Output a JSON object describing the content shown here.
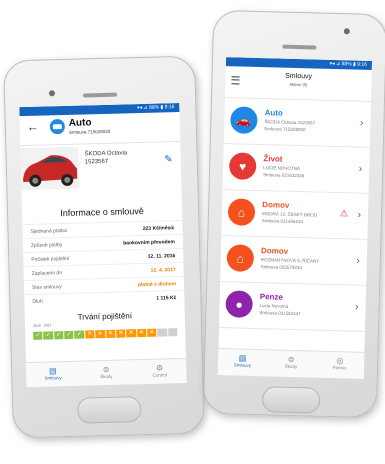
{
  "detail": {
    "status": "▾◂ ⊿ 88% ▮ 9:16",
    "title": "Auto",
    "subtitle": "Smlouva 715028030",
    "car_line1": "ŠKODA Octavia",
    "car_line2": "1523567",
    "info_title": "Informace o smlouvě",
    "rows": [
      {
        "k": "Sjednaná platba",
        "v": "223 Kč/měsíc",
        "warn": false
      },
      {
        "k": "Způsob platby",
        "v": "bankovním převodem",
        "warn": false
      },
      {
        "k": "Počátek pojištění",
        "v": "12. 11. 2016",
        "warn": false
      },
      {
        "k": "Zaplaceno do",
        "v": "12. 4. 2017",
        "warn": true
      },
      {
        "k": "Stav smlouvy",
        "v": "platná s dluhem",
        "warn": true
      },
      {
        "k": "Dluh",
        "v": "1 115 Kč",
        "warn": false
      }
    ],
    "duration_title": "Trvání pojištění",
    "year_a": "2016",
    "year_b": "2017",
    "timeline": [
      "ok",
      "ok",
      "ok",
      "ok",
      "ok",
      "x",
      "x",
      "x",
      "x",
      "x",
      "x",
      "x",
      "f",
      "f"
    ],
    "timeline_colors": {
      "ok": "#8bc34a",
      "x": "#ff9800",
      "f": "#cfcfcf"
    },
    "tabs": [
      {
        "label": "Smlouvy",
        "icon": "document-icon",
        "active": true
      },
      {
        "label": "Škody",
        "icon": "car-crash-icon",
        "active": false
      },
      {
        "label": "Control",
        "icon": "gear-icon",
        "active": false
      }
    ]
  },
  "list": {
    "status": "▾◂ ⊿ 88% ▮ 9:16",
    "title": "Smlouvy",
    "subtitle": "Aktivní (5)",
    "items": [
      {
        "title": "Auto",
        "l1": "ŠKODA Octavia 1523567",
        "l2": "Smlouva 715028050",
        "color": "#1e88e5",
        "icon": "car-icon",
        "warn": false
      },
      {
        "title": "Život",
        "l1": "LUCIE NOVOTNÁ",
        "l2": "Smlouva 021632345",
        "color": "#e53935",
        "icon": "heart-icon",
        "warn": false
      },
      {
        "title": "Domov",
        "l1": "MODRÁ 12, ČESKÝ BROD",
        "l2": "Smlouva 031456234",
        "color": "#f4511e",
        "icon": "house-icon",
        "warn": true
      },
      {
        "title": "Domov",
        "l1": "ROZMARÝNOVÁ 6, ŘÍČANY",
        "l2": "Smlouva 033579234",
        "color": "#f4511e",
        "icon": "house-icon",
        "warn": false
      },
      {
        "title": "Penze",
        "l1": "Lucie Novotná",
        "l2": "Smlouva 031562447",
        "color": "#8e24aa",
        "icon": "piggy-bank-icon",
        "warn": false
      }
    ],
    "tabs": [
      {
        "label": "Smlouvy",
        "icon": "document-icon",
        "active": true
      },
      {
        "label": "Škody",
        "icon": "car-crash-icon",
        "active": false
      },
      {
        "label": "Pomoc",
        "icon": "lifebuoy-icon",
        "active": false
      }
    ]
  }
}
